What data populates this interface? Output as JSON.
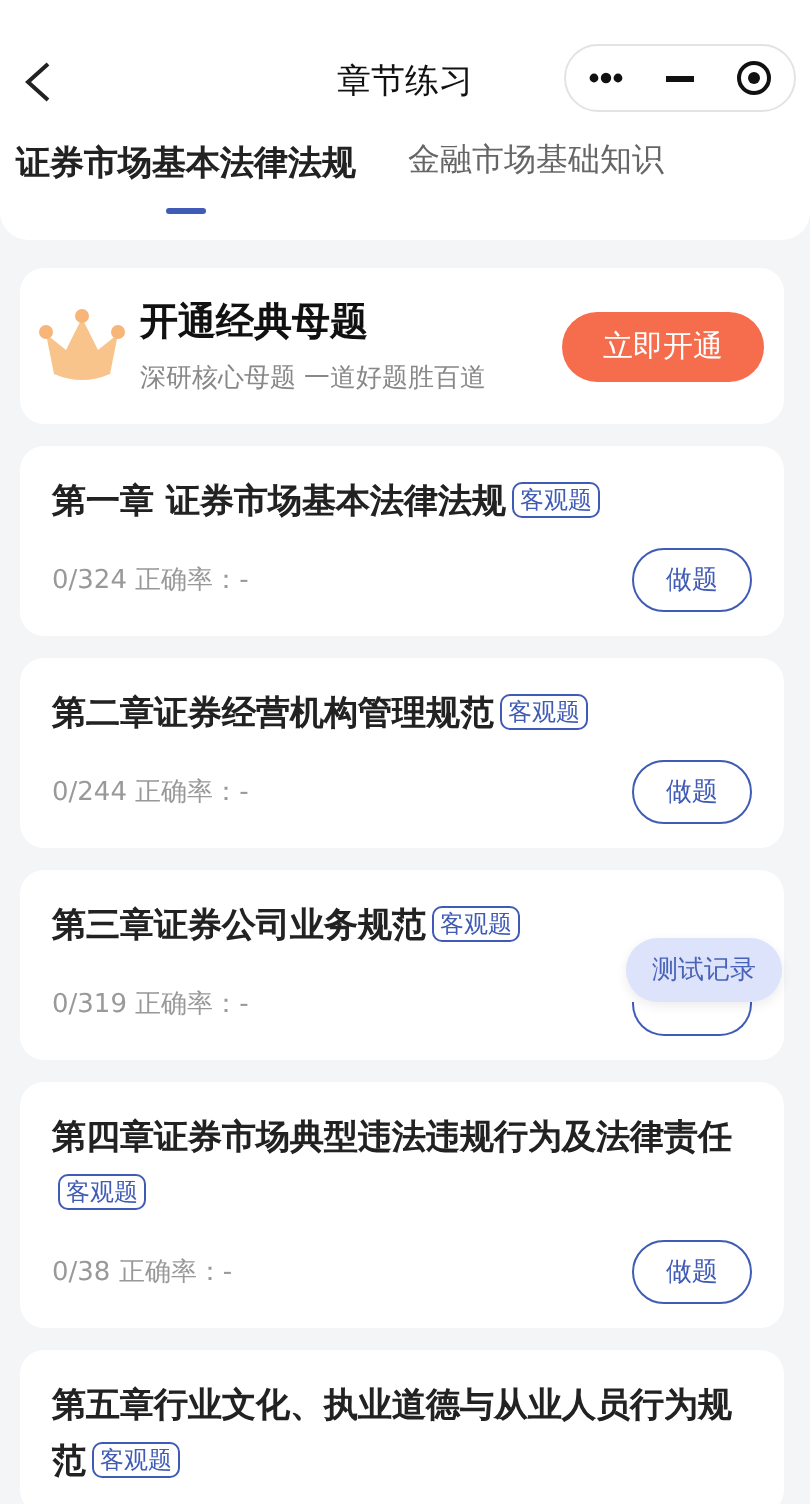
{
  "nav": {
    "title": "章节练习"
  },
  "tabs": [
    {
      "label": "证券市场基本法律法规",
      "selected": true
    },
    {
      "label": "金融市场基础知识",
      "selected": false
    }
  ],
  "promo": {
    "title": "开通经典母题",
    "subtitle": "深研核心母题 一道好题胜百道",
    "button": "立即开通"
  },
  "chapters": [
    {
      "title": "第一章 证券市场基本法律法规",
      "tag": "客观题",
      "stats": "0/324 正确率：-",
      "button": "做题"
    },
    {
      "title": "第二章证券经营机构管理规范",
      "tag": "客观题",
      "stats": "0/244 正确率：-",
      "button": "做题"
    },
    {
      "title": "第三章证券公司业务规范",
      "tag": "客观题",
      "stats": "0/319 正确率：-"
    },
    {
      "title": "第四章证券市场典型违法违规行为及法律责任",
      "tag": "客观题",
      "stats": "0/38 正确率：-",
      "button": "做题"
    },
    {
      "title": "第五章行业文化、执业道德与从业人员行为规范",
      "tag": "客观题"
    }
  ],
  "floating_button": "测试记录"
}
